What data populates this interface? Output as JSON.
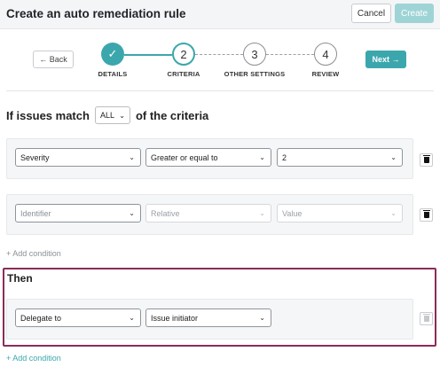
{
  "header": {
    "title": "Create an auto remediation rule",
    "cancel_label": "Cancel",
    "create_label": "Create"
  },
  "stepper": {
    "back_label": "← Back",
    "next_label": "Next →",
    "steps": [
      {
        "number": "✓",
        "label": "DETAILS",
        "state": "done"
      },
      {
        "number": "2",
        "label": "CRITERIA",
        "state": "active"
      },
      {
        "number": "3",
        "label": "OTHER SETTINGS",
        "state": "pending"
      },
      {
        "number": "4",
        "label": "REVIEW",
        "state": "pending"
      }
    ]
  },
  "criteria": {
    "prefix": "If issues match",
    "match_value": "ALL",
    "suffix": "of the criteria",
    "conditions": [
      {
        "field": "Severity",
        "operator": "Greater or equal to",
        "value": "2",
        "disabled": false
      },
      {
        "field": "Identifier",
        "operator": "Relative",
        "value": "Value",
        "disabled": true
      }
    ],
    "add_condition_label": "+ Add condition"
  },
  "then": {
    "title": "Then",
    "action": "Delegate to",
    "target": "Issue initiator",
    "add_condition_label": "+ Add condition"
  },
  "colors": {
    "accent": "#3ba7ad",
    "then_border": "#8b2b58"
  }
}
